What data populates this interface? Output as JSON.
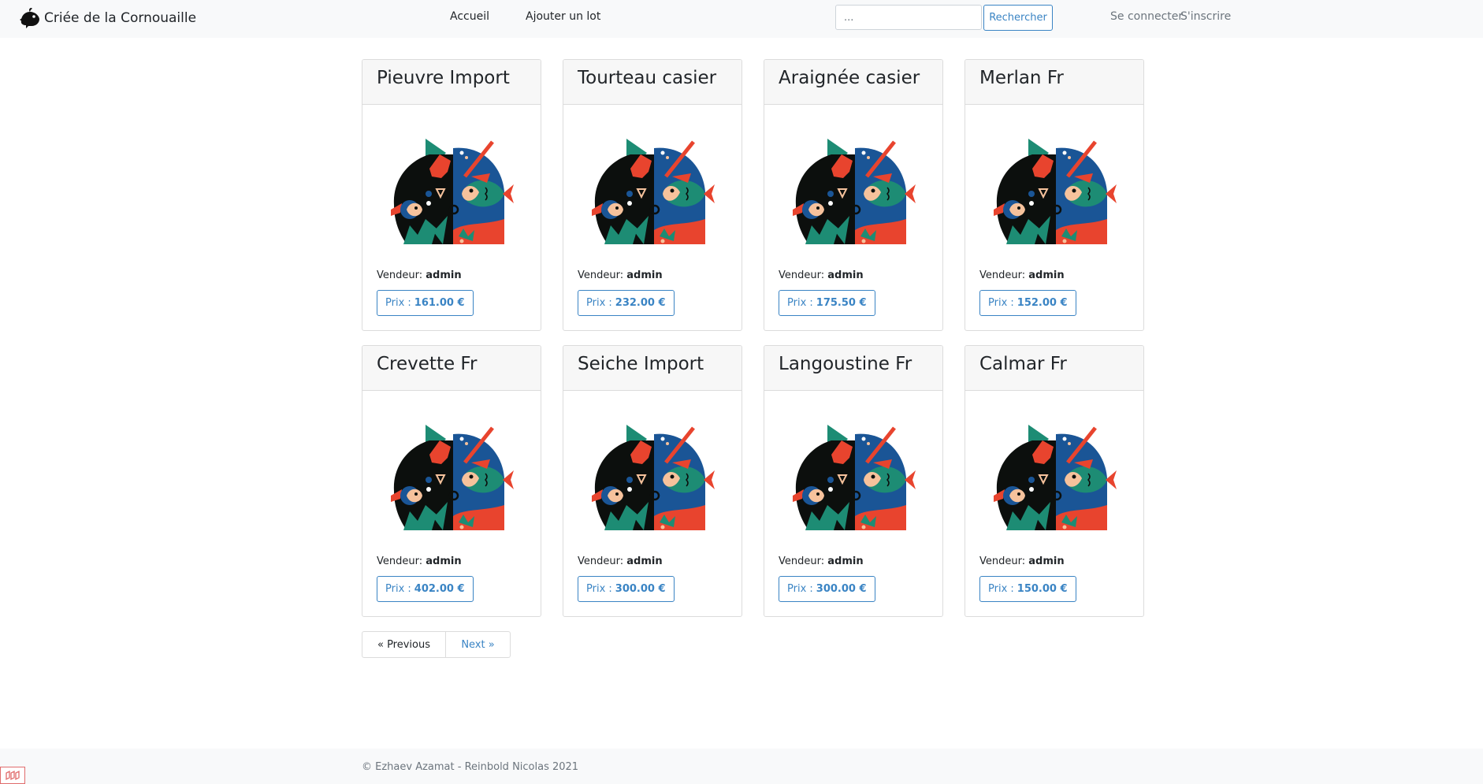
{
  "navbar": {
    "brand": "Criée de la Cornouaille",
    "links": {
      "home": "Accueil",
      "add_lot": "Ajouter un lot"
    },
    "search": {
      "placeholder": "...",
      "button": "Rechercher"
    },
    "auth": {
      "login": "Se connecter",
      "register": "S'inscrire"
    }
  },
  "lots": [
    {
      "title": "Pieuvre Import",
      "seller_label": "Vendeur:",
      "seller": "admin",
      "price_label": "Prix :",
      "price": "161.00 €"
    },
    {
      "title": "Tourteau casier",
      "seller_label": "Vendeur:",
      "seller": "admin",
      "price_label": "Prix :",
      "price": "232.00 €"
    },
    {
      "title": "Araignée casier",
      "seller_label": "Vendeur:",
      "seller": "admin",
      "price_label": "Prix :",
      "price": "175.50 €"
    },
    {
      "title": "Merlan Fr",
      "seller_label": "Vendeur:",
      "seller": "admin",
      "price_label": "Prix :",
      "price": "152.00 €"
    },
    {
      "title": "Crevette Fr",
      "seller_label": "Vendeur:",
      "seller": "admin",
      "price_label": "Prix :",
      "price": "402.00 €"
    },
    {
      "title": "Seiche Import",
      "seller_label": "Vendeur:",
      "seller": "admin",
      "price_label": "Prix :",
      "price": "300.00 €"
    },
    {
      "title": "Langoustine Fr",
      "seller_label": "Vendeur:",
      "seller": "admin",
      "price_label": "Prix :",
      "price": "300.00 €"
    },
    {
      "title": "Calmar Fr",
      "seller_label": "Vendeur:",
      "seller": "admin",
      "price_label": "Prix :",
      "price": "150.00 €"
    }
  ],
  "pagination": {
    "previous": "« Previous",
    "next": "Next »"
  },
  "footer": {
    "text": "© Ezhaev Azamat - Reinbold Nicolas 2021"
  },
  "colors": {
    "accent": "#3a84c4",
    "navbar_bg": "#f8f9fa",
    "illustration": [
      "#0c0f0d",
      "#1a5596",
      "#e8442e",
      "#1d8c74",
      "#f6c29c"
    ]
  },
  "icons": {
    "brand": "fish-logo-icon",
    "lot_image": "fish-illustration",
    "debug": "debugbar-icon"
  }
}
